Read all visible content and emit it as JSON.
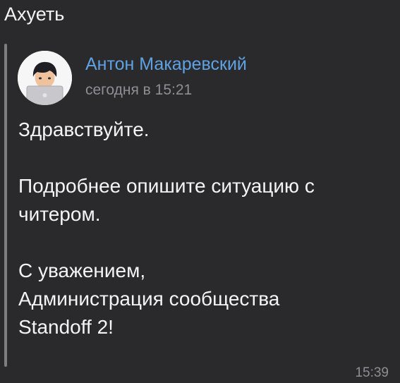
{
  "header": {
    "text": "Ахуеть"
  },
  "forwarded": {
    "author": "Антон Макаревский",
    "date": "сегодня в 15:21",
    "avatar_icon": "person-with-laptop-avatar",
    "paragraphs": [
      "Здравствуйте.",
      "Подробнее опишите ситуацию с\nчитером.",
      "С уважением,\nАдминистрация сообщества\nStandoff 2!"
    ]
  },
  "footer": {
    "time": "15:39"
  },
  "colors": {
    "background": "#2a2a2c",
    "author": "#5fa2e4",
    "meta": "#8e8e93",
    "bar": "#7d7d82"
  }
}
